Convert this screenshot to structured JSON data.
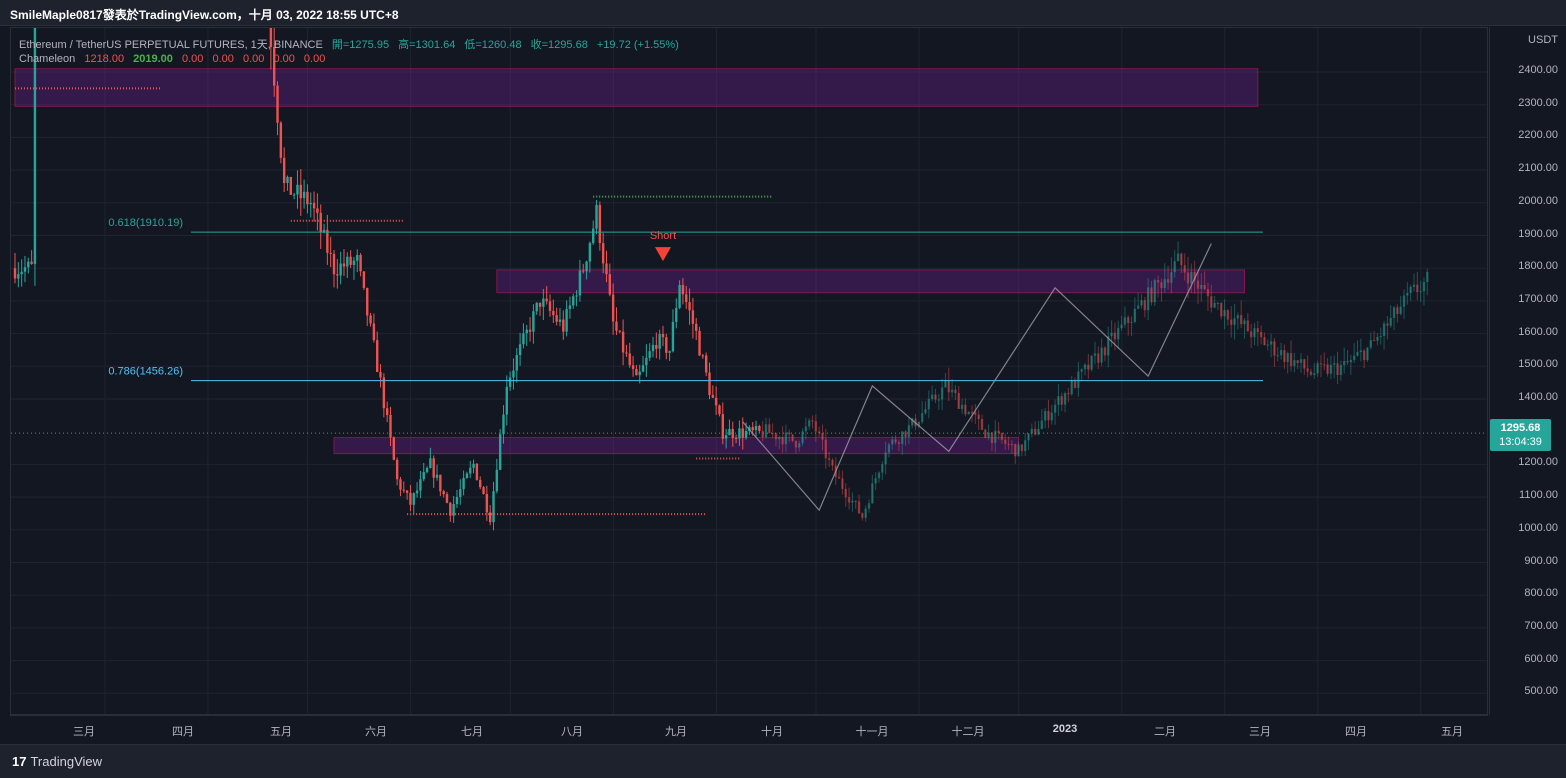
{
  "header": {
    "title": "SmileMaple0817發表於TradingView.com，十月 03, 2022 18:55 UTC+8"
  },
  "legend": {
    "symbol": "Ethereum / TetherUS PERPETUAL FUTURES, 1天, BINANCE",
    "open": "開=1275.95",
    "high": "高=1301.64",
    "low": "低=1260.48",
    "close": "收=1295.68",
    "change": "+19.72 (+1.55%)",
    "indicator_name": "Chameleon",
    "indicator_values": [
      "1218.00",
      "2019.00",
      "0.00",
      "0.00",
      "0.00",
      "0.00",
      "0.00"
    ]
  },
  "price_axis": {
    "currency": "USDT",
    "ticks": [
      2400,
      2300,
      2200,
      2100,
      2000,
      1900,
      1800,
      1700,
      1600,
      1500,
      1400,
      1200,
      1100,
      1000,
      900,
      800,
      700,
      600,
      500
    ],
    "current_price": "1295.68",
    "countdown": "13:04:39"
  },
  "time_axis": {
    "labels": [
      "三月",
      "四月",
      "五月",
      "六月",
      "七月",
      "八月",
      "九月",
      "十月",
      "十一月",
      "十二月",
      "2023",
      "二月",
      "三月",
      "四月",
      "五月"
    ]
  },
  "footer": {
    "brand": "TradingView",
    "brand_mark": "17"
  },
  "colors": {
    "up": "#26a69a",
    "down": "#ef5350",
    "zone": "#7b1fa2",
    "fib_618": "#26a69a",
    "fib_786": "#4fc3f7",
    "background": "#131722"
  },
  "chart_data": {
    "type": "candlestick",
    "y_range": [
      400,
      2470
    ],
    "fib_levels": [
      {
        "label": "0.618(1910.19)",
        "value": 1910.19
      },
      {
        "label": "0.786(1456.26)",
        "value": 1456.26
      }
    ],
    "zones": [
      {
        "from": "2022-02-20",
        "to": "2023-03-01",
        "low": 2295,
        "high": 2410
      },
      {
        "from": "2022-07-15",
        "to": "2023-02-25",
        "low": 1725,
        "high": 1795
      },
      {
        "from": "2022-05-27",
        "to": "2022-12-19",
        "low": 1233,
        "high": 1282
      }
    ],
    "dotted_levels": [
      {
        "from": "2022-02-20",
        "to": "2022-04-05",
        "value": 2350,
        "color": "#ef5350"
      },
      {
        "from": "2022-05-14",
        "to": "2022-06-17",
        "value": 1945,
        "color": "#ef5350"
      },
      {
        "from": "2022-08-13",
        "to": "2022-10-06",
        "value": 2019,
        "color": "#4caf50"
      },
      {
        "from": "2022-06-18",
        "to": "2022-09-16",
        "value": 1048,
        "color": "#ef5350"
      },
      {
        "from": "2022-09-13",
        "to": "2022-09-26",
        "value": 1218,
        "color": "#ef5350"
      }
    ],
    "annotation": {
      "text": "Short",
      "date": "2022-09-03",
      "value": 1840
    },
    "zigzag": [
      [
        "2022-09-27",
        1330
      ],
      [
        "2022-10-20",
        1060
      ],
      [
        "2022-11-05",
        1440
      ],
      [
        "2022-11-28",
        1240
      ],
      [
        "2022-12-30",
        1740
      ],
      [
        "2023-01-27",
        1470
      ],
      [
        "2023-02-15",
        1875
      ]
    ],
    "current_price": 1295.68,
    "ohlc_anchors": [
      [
        "2022-02-26",
        2600
      ],
      [
        "2022-03-20",
        2950
      ],
      [
        "2022-04-10",
        3300
      ],
      [
        "2022-05-01",
        2850
      ],
      [
        "2022-05-08",
        2500
      ],
      [
        "2022-05-12",
        2050
      ],
      [
        "2022-05-20",
        2000
      ],
      [
        "2022-05-27",
        1800
      ],
      [
        "2022-06-03",
        1820
      ],
      [
        "2022-06-10",
        1450
      ],
      [
        "2022-06-15",
        1150
      ],
      [
        "2022-06-19",
        1080
      ],
      [
        "2022-06-25",
        1200
      ],
      [
        "2022-07-01",
        1060
      ],
      [
        "2022-07-08",
        1200
      ],
      [
        "2022-07-13",
        1040
      ],
      [
        "2022-07-18",
        1450
      ],
      [
        "2022-07-24",
        1600
      ],
      [
        "2022-07-28",
        1700
      ],
      [
        "2022-08-04",
        1620
      ],
      [
        "2022-08-10",
        1800
      ],
      [
        "2022-08-14",
        1970
      ],
      [
        "2022-08-19",
        1630
      ],
      [
        "2022-08-26",
        1450
      ],
      [
        "2022-09-01",
        1580
      ],
      [
        "2022-09-05",
        1550
      ],
      [
        "2022-09-08",
        1760
      ],
      [
        "2022-09-13",
        1600
      ],
      [
        "2022-09-17",
        1430
      ],
      [
        "2022-09-21",
        1300
      ],
      [
        "2022-10-02",
        1295
      ]
    ]
  }
}
